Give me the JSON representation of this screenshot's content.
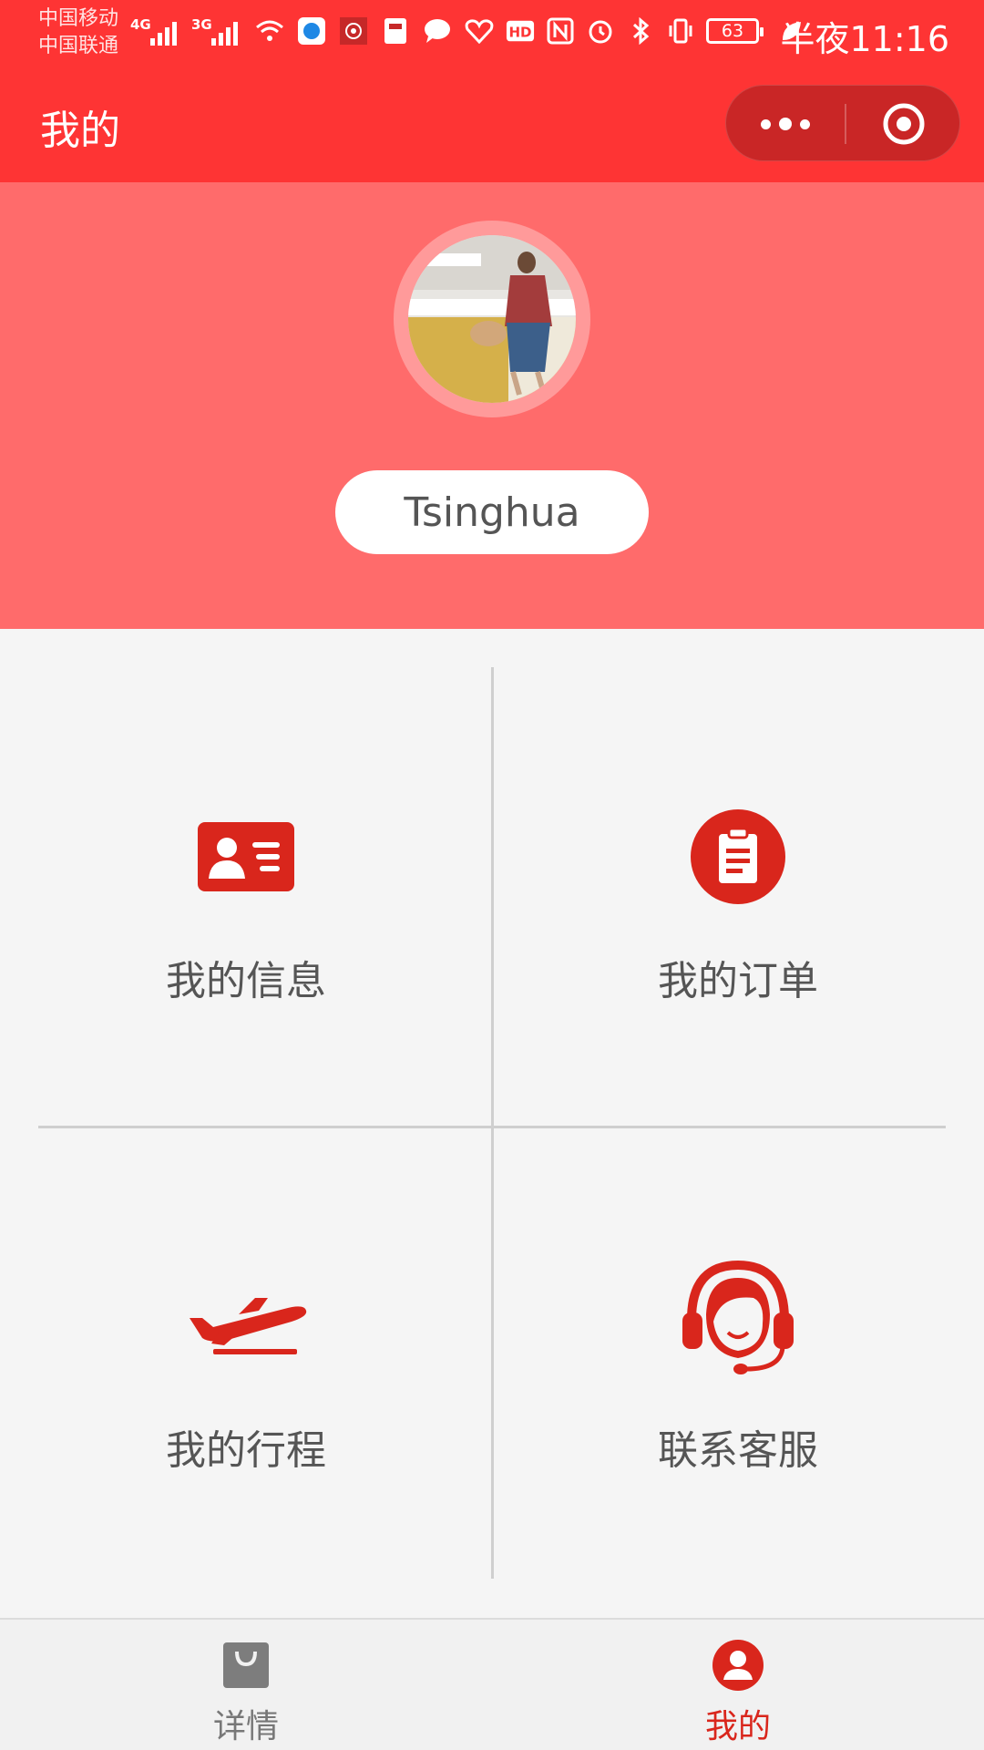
{
  "status_bar": {
    "carrier_1": "中国移动",
    "carrier_2": "中国联通",
    "net_1": "4G",
    "net_2": "3G",
    "battery": "63",
    "time": "半夜11:16",
    "icons": [
      "signal-icon",
      "wifi-icon",
      "app-icon",
      "flower-icon",
      "app-icon",
      "chat-icon",
      "heart-icon",
      "hd-icon",
      "nfc-icon",
      "alarm-icon",
      "bluetooth-icon",
      "vibrate-icon",
      "leaf-icon"
    ]
  },
  "navbar": {
    "title": "我的",
    "more_icon": "more-dots-icon",
    "close_icon": "target-circle-icon"
  },
  "profile": {
    "username": "Tsinghua",
    "avatar_icon": "user-avatar-photo"
  },
  "menu": [
    {
      "label": "我的信息",
      "icon": "id-card-icon"
    },
    {
      "label": "我的订单",
      "icon": "clipboard-icon"
    },
    {
      "label": "我的行程",
      "icon": "airplane-icon"
    },
    {
      "label": "联系客服",
      "icon": "headset-support-icon"
    }
  ],
  "tabs": [
    {
      "label": "详情",
      "icon": "shopping-bag-icon",
      "active": false
    },
    {
      "label": "我的",
      "icon": "person-icon",
      "active": true
    }
  ],
  "colors": {
    "primary": "#fe3434",
    "profile_bg": "#ff6b6b",
    "icon_red": "#d9261c",
    "tab_active": "#d9261c",
    "tab_inactive": "#777777"
  }
}
